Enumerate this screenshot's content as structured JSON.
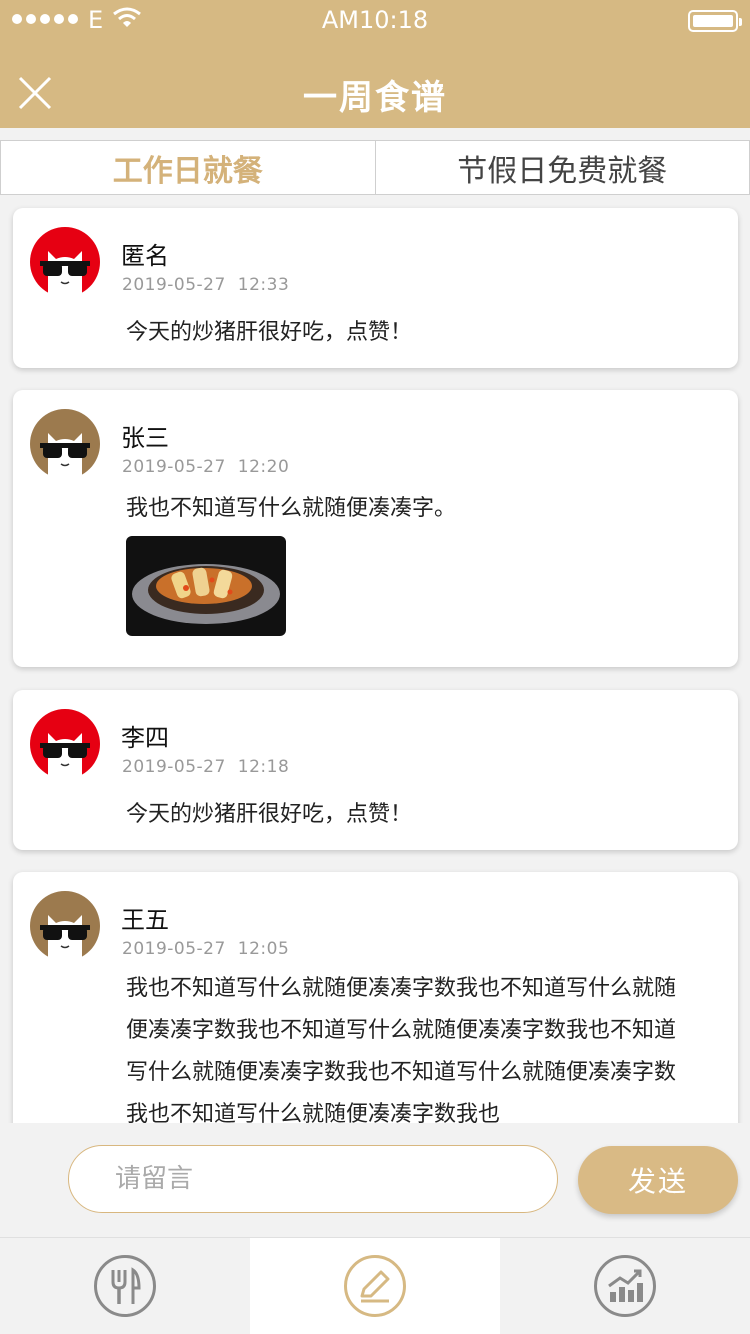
{
  "status_bar": {
    "carrier": "E",
    "time": "AM10:18"
  },
  "header": {
    "title": "一周食谱"
  },
  "tabs": [
    {
      "label": "工作日就餐",
      "active": true
    },
    {
      "label": "节假日免费就餐",
      "active": false
    }
  ],
  "comments": [
    {
      "user": "匿名",
      "date": "2019-05-27",
      "time": "12:33",
      "text": "今天的炒猪肝很好吃，点赞！",
      "avatar_color": "#e60012",
      "has_image": false
    },
    {
      "user": "张三",
      "date": "2019-05-27",
      "time": "12:20",
      "text": "我也不知道写什么就随便凑凑字。",
      "avatar_color": "#9c7a4e",
      "has_image": true
    },
    {
      "user": "李四",
      "date": "2019-05-27",
      "time": "12:18",
      "text": "今天的炒猪肝很好吃，点赞！",
      "avatar_color": "#e60012",
      "has_image": false
    },
    {
      "user": "王五",
      "date": "2019-05-27",
      "time": "12:05",
      "text": "我也不知道写什么就随便凑凑字数我也不知道写什么就随便凑凑字数我也不知道写什么就随便凑凑字数我也不知道写什么就随便凑凑字数我也不知道写什么就随便凑凑字数我也不知道写什么就随便凑凑字数我也",
      "avatar_color": "#9c7a4e",
      "has_image": false
    }
  ],
  "input": {
    "placeholder": "请留言",
    "value": ""
  },
  "send_button": {
    "label": "发送"
  },
  "bottom_nav": [
    {
      "icon": "cutlery-icon",
      "active": false
    },
    {
      "icon": "edit-icon",
      "active": true
    },
    {
      "icon": "chart-icon",
      "active": false
    }
  ],
  "colors": {
    "accent": "#d6b983",
    "avatar_red": "#e60012",
    "avatar_brown": "#9c7a4e"
  }
}
